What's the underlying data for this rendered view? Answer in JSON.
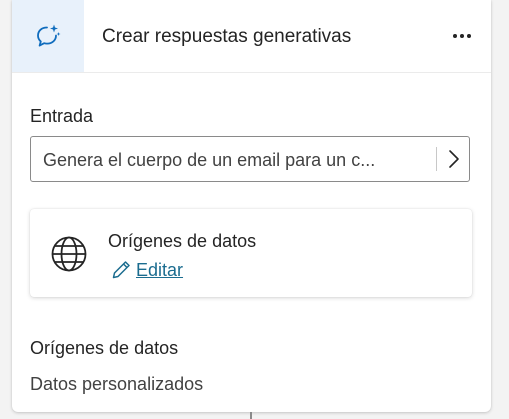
{
  "header": {
    "icon": "chat-sparkle-icon",
    "title": "Crear respuestas generativas",
    "more_icon": "more-horizontal-icon"
  },
  "input_section": {
    "label": "Entrada",
    "value": "Genera el cuerpo de un email para un c...",
    "action_icon": "chevron-right-icon"
  },
  "data_sources_card": {
    "icon": "globe-icon",
    "title": "Orígenes de datos",
    "edit_icon": "pencil-icon",
    "edit_label": "Editar"
  },
  "summary": {
    "title": "Orígenes de datos",
    "value": "Datos personalizados"
  },
  "colors": {
    "accent": "#0f6cbd",
    "header_icon_bg": "#e8f1fb",
    "link": "#1b6c8f"
  }
}
